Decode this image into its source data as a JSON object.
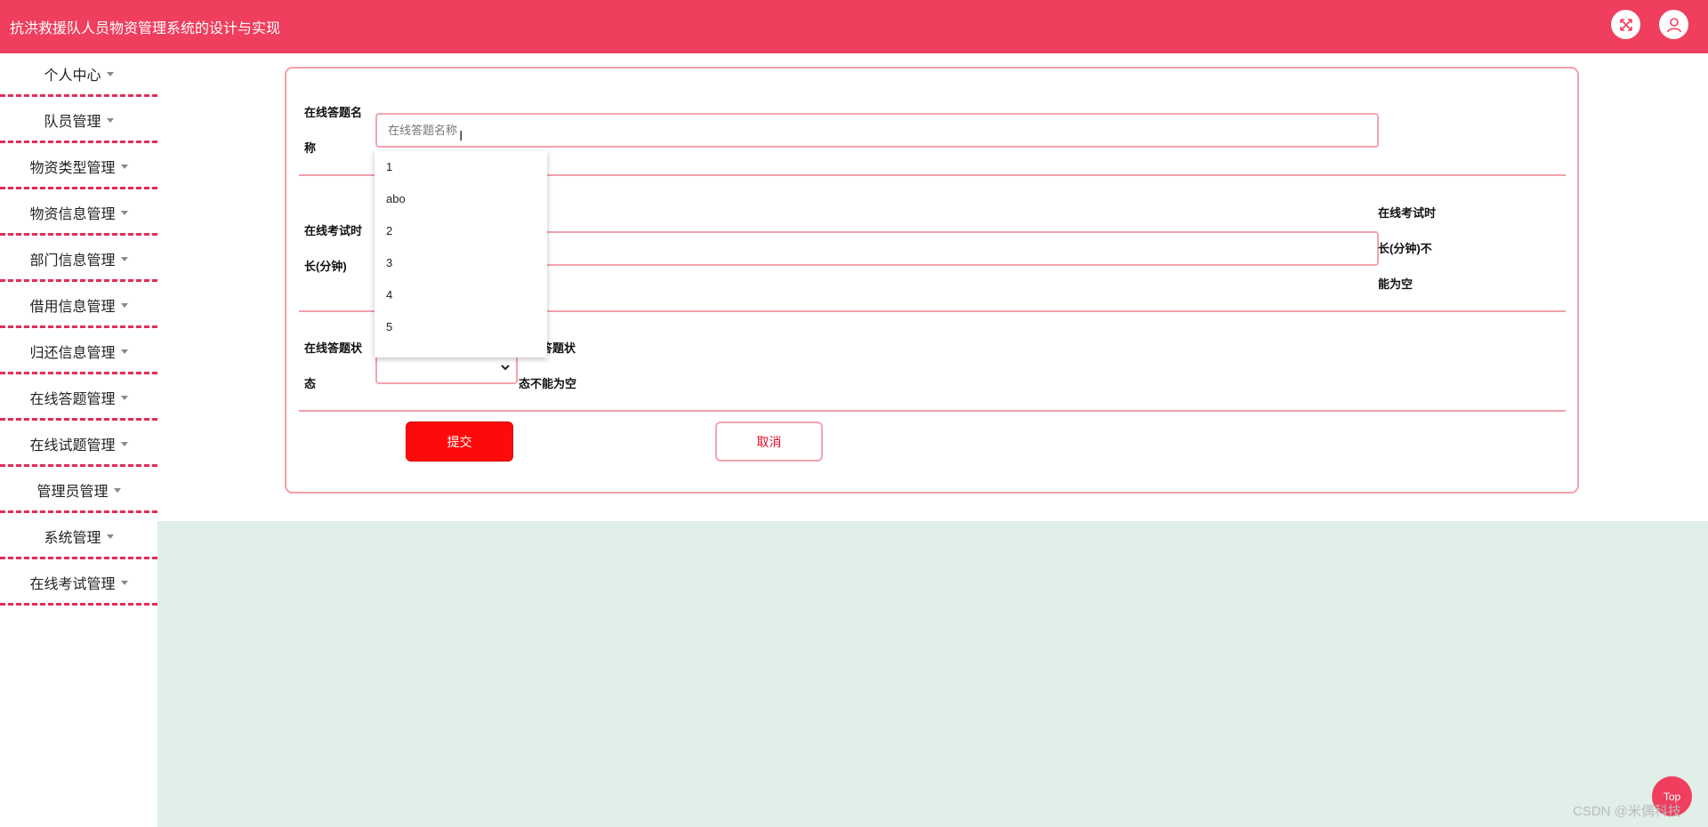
{
  "header": {
    "title": "抗洪救援队人员物资管理系统的设计与实现",
    "fullscreen_icon": "expand-icon",
    "user_icon": "user-icon",
    "brand_color": "#f03e5e"
  },
  "sidebar": {
    "items": [
      {
        "label": "个人中心"
      },
      {
        "label": "队员管理"
      },
      {
        "label": "物资类型管理"
      },
      {
        "label": "物资信息管理"
      },
      {
        "label": "部门信息管理"
      },
      {
        "label": "借用信息管理"
      },
      {
        "label": "归还信息管理"
      },
      {
        "label": "在线答题管理"
      },
      {
        "label": "在线试题管理"
      },
      {
        "label": "管理员管理"
      },
      {
        "label": "系统管理"
      },
      {
        "label": "在线考试管理"
      }
    ]
  },
  "form": {
    "name_label_1": "在线答题名",
    "name_label_2": "称",
    "name_placeholder": "在线答题名称",
    "duration_label_1": "在线考试时",
    "duration_label_2": "长(分钟)",
    "duration_error_1": "在线考试时",
    "duration_error_2": "长(分钟)不",
    "duration_error_3": "能为空",
    "status_label_1": "在线答题状",
    "status_label_2": "态",
    "status_error_1": "答题状",
    "status_error_2": "态不能为空",
    "submit_label": "提交",
    "cancel_label": "取消"
  },
  "autocomplete": {
    "options": [
      "1",
      "abo",
      "2",
      "3",
      "4",
      "5"
    ]
  },
  "footer": {
    "top_label": "Top",
    "watermark": "CSDN @米偶科技"
  }
}
